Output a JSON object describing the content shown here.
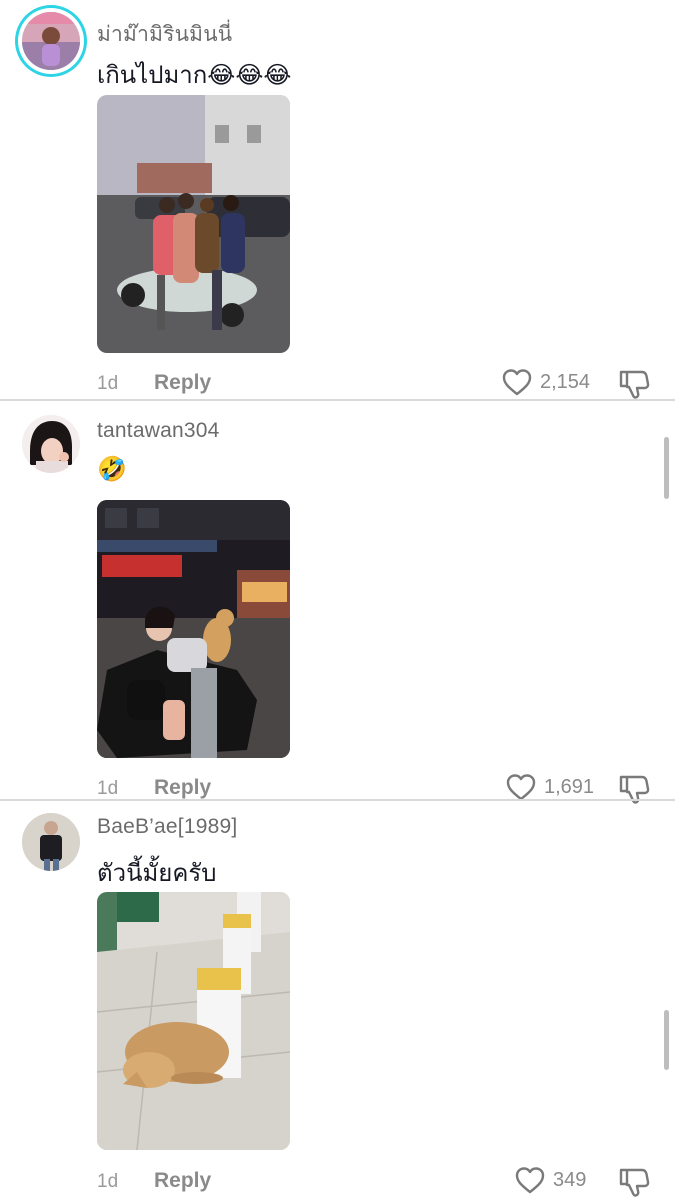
{
  "comments": [
    {
      "username": "ม่าม๊ามิรินมินนี่",
      "text": "เกินไปมาก😂😂😂",
      "time": "1d",
      "reply": "Reply",
      "likes": "2,154"
    },
    {
      "username": "tantawan304",
      "text": "🤣",
      "time": "1d",
      "reply": "Reply",
      "likes": "1,691"
    },
    {
      "username": "BaeB’ae[1989]",
      "text": "ตัวนี้มั้ยครับ",
      "time": "1d",
      "reply": "Reply",
      "likes": "349"
    }
  ],
  "icons": {
    "like": "heart-outline-icon",
    "dislike": "thumbs-down-icon"
  },
  "colors": {
    "avatar_ring": "#2dd4e6",
    "muted_text": "#8a8a8a"
  }
}
